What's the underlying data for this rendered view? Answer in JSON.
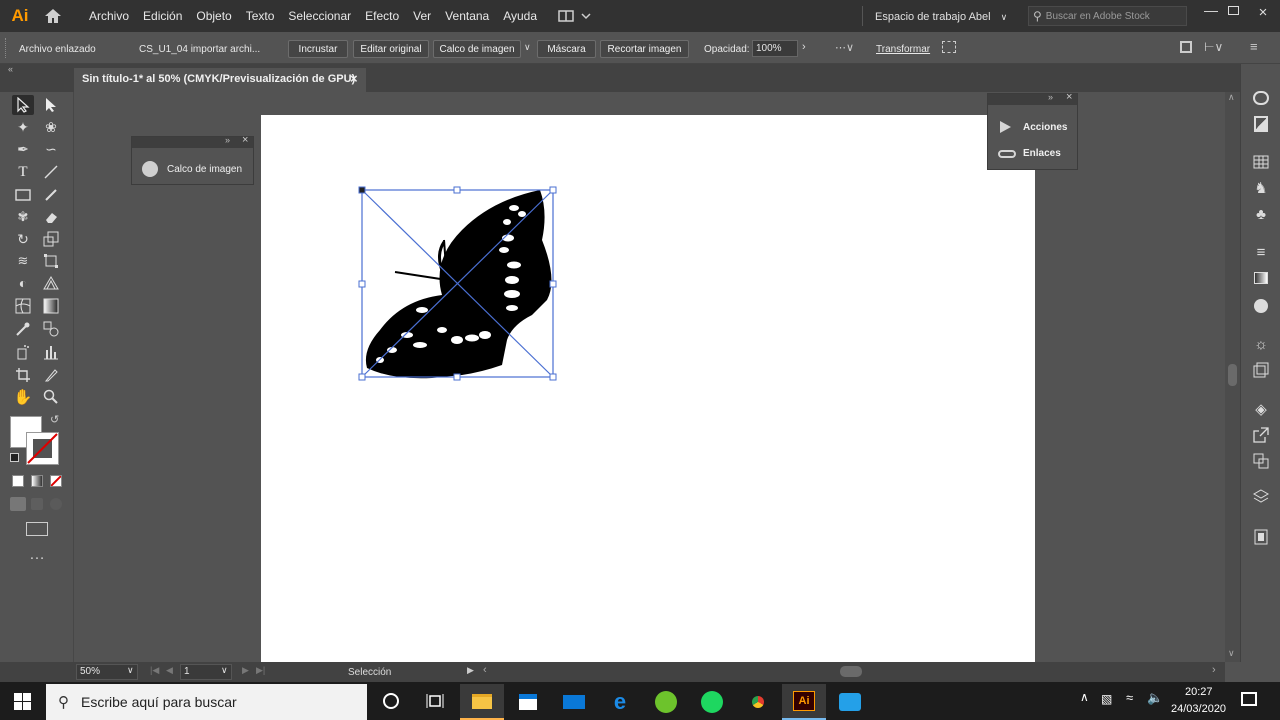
{
  "app": {
    "logo": "Ai"
  },
  "menu": [
    "Archivo",
    "Edición",
    "Objeto",
    "Texto",
    "Seleccionar",
    "Efecto",
    "Ver",
    "Ventana",
    "Ayuda"
  ],
  "workspace": "Espacio de trabajo Abel",
  "search_placeholder": "Buscar en Adobe Stock",
  "control": {
    "linked_file": "Archivo enlazado",
    "file_name": "CS_U1_04 importar archi...",
    "embed": "Incrustar",
    "edit_original": "Editar original",
    "image_trace": "Calco de imagen",
    "mask": "Máscara",
    "crop": "Recortar imagen",
    "opacity_label": "Opacidad:",
    "opacity_value": "100%",
    "transform": "Transformar"
  },
  "document_tab": {
    "title": "Sin título-1* al 50% (CMYK/Previsualización de GPU)",
    "close": "×"
  },
  "image_trace_panel": {
    "label": "Calco de imagen"
  },
  "actions_panel": {
    "items": [
      "Acciones",
      "Enlaces"
    ]
  },
  "status": {
    "zoom": "50%",
    "page": "1",
    "tool": "Selección"
  },
  "taskbar": {
    "search_placeholder": "Escribe aquí para buscar",
    "time": "20:27",
    "date": "24/03/2020"
  },
  "colors": {
    "accent": "#ff9a00",
    "selection": "#4a6fd2"
  }
}
